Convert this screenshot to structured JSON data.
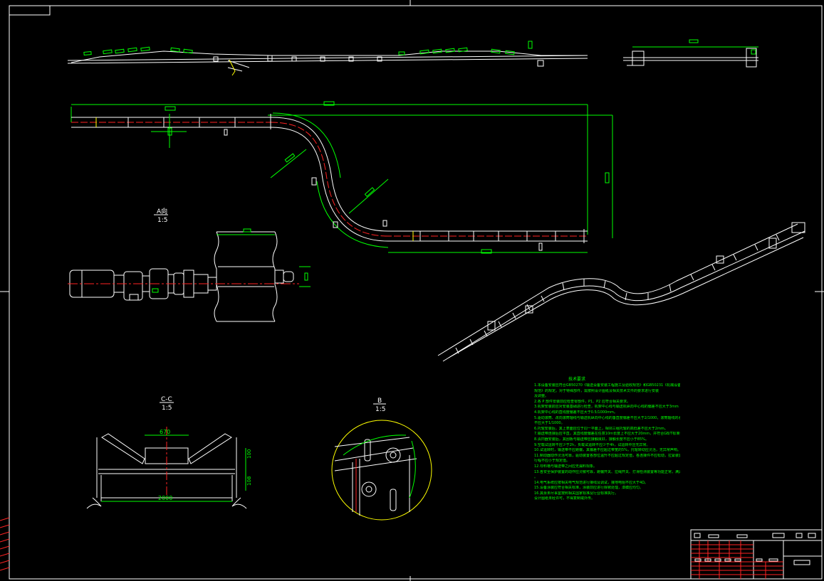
{
  "drawing": {
    "background": "#000000",
    "line_colors": {
      "outline": "#ffffff",
      "dimension": "#00ff00",
      "centerline": "#ff2222",
      "hidden": "#ffff00",
      "title_block": "#ff2222"
    }
  },
  "views": {
    "section_a": {
      "label": "A向",
      "scale": "1:5"
    },
    "section_c": {
      "label": "C-C",
      "scale": "1:5",
      "dim_top": "670",
      "dim_bottom": "2000",
      "dim_right_1": "100",
      "dim_right_2": "108"
    },
    "section_b": {
      "label": "B",
      "scale": "1:5"
    }
  },
  "notes": {
    "heading": "技术要求",
    "lines": [
      "1.本设备安装应符合GB50270《输送设备安装工程施工及验收规范》和GB50231《机械设备安装工程施工及验收通用",
      "规范》的规定。对于特殊部件，需按照设计图纸及相关技术文件的要求进行安装",
      "及调整。",
      "2.各  P  部件安装前应检查零部件，P1、P2 应符合相关要求。",
      "3.机架安装前应对安装基础进行检查，机架中心线与输送机纵向中心线的偏差不应大于3mm",
      "4.机架中心线的直线度偏差不应大于0.5/1000mm。",
      "5.驱动滚筒、改向滚筒轴线与输送机纵向中心线的垂直度偏差不应大于2/1000，滚筒轴线的水平度偏差",
      "不应大于1/1000。",
      "6.托辊安装后，其上表面应位于同一平面上，相邻三组托辊的高低差不应大于2mm。",
      "7.输送带连接后应平直，其直线度偏差在任意10m长度上不应大于20mm，并符合GB/T标准要求。",
      "8.清扫器安装后，其刮板与输送带应接触良好，接触长度不应小于85%。",
      "9.空载试运转不应少于2h，负载试运转不应少于4h，试运转中应无异常。",
      "10.试运转时，输送带不应跑偏，其偏差不应超过带宽的5%，托辊转动应灵活，无异常声响。",
      "11.制动器动作灵活可靠，驱动装置各部位温升不应超过规定值，各连接件不应松动，拉紧装置调整一次",
      "行程不应小于规定值。",
      "12.导料槽与输送带之间应无漏料现象。",
      "13.各安全保护装置的动作应灵敏可靠，跑偏开关、拉绳开关、打滑检测装置等功能正常，满足使用要求",
      "。",
      "14.电气系统应按相关电气规范进行接线及调试，接地电阻不应大于4Ω。",
      "15.设备涂装应符合相关标准，涂装前应进行除锈处理，漆膜应均匀。",
      "16.其余未尽事宜按照相关国家标准及行业标准执行。",
      "设计图纸未经许可，不得复制或外传。"
    ]
  },
  "title_block": {
    "cells": [
      "",
      "",
      "",
      "",
      "",
      "",
      "",
      ""
    ]
  }
}
